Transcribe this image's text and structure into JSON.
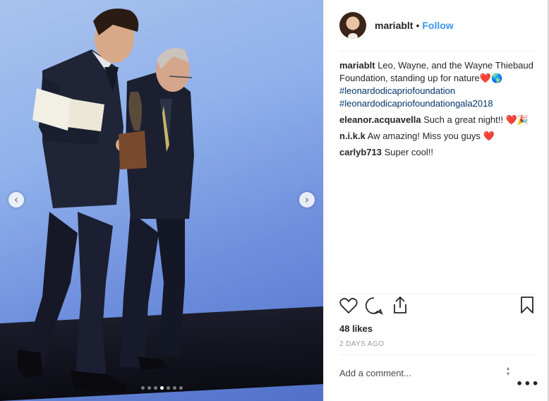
{
  "post": {
    "carousel": {
      "prev_glyph": "‹",
      "next_glyph": "›",
      "dot_count": 7,
      "active_dot": 4
    },
    "header": {
      "username": "mariablt",
      "separator": "•",
      "follow_label": "Follow"
    },
    "caption": {
      "user": "mariablt",
      "text": "Leo, Wayne, and the Wayne Thiebaud Foundation, standing up for nature",
      "emoji": "❤️🌎",
      "hashtag_1": "#leonardodicapriofoundation",
      "hashtag_2": "#leonardodicapriofoundationgala2018"
    },
    "comments": [
      {
        "user": "eleanor.acquavella",
        "text": "Such a great night!! ❤️🎉"
      },
      {
        "user": "n.i.k.k",
        "text": "Aw amazing! Miss you guys ❤️"
      },
      {
        "user": "carlyb713",
        "text": "Super cool!!"
      }
    ],
    "actions": {
      "like_icon": "heart-icon",
      "comment_icon": "comment-bubble-icon",
      "share_icon": "share-icon",
      "save_icon": "bookmark-icon"
    },
    "likes": "48 likes",
    "timestamp": "2 DAYS AGO",
    "add_comment_placeholder": "Add a comment...",
    "stepper_up": "▴",
    "stepper_down": "▾",
    "more_options": "•••",
    "colors": {
      "accent": "#3897f0",
      "hashtag": "#003569",
      "muted": "#999999",
      "text": "#262626"
    }
  }
}
